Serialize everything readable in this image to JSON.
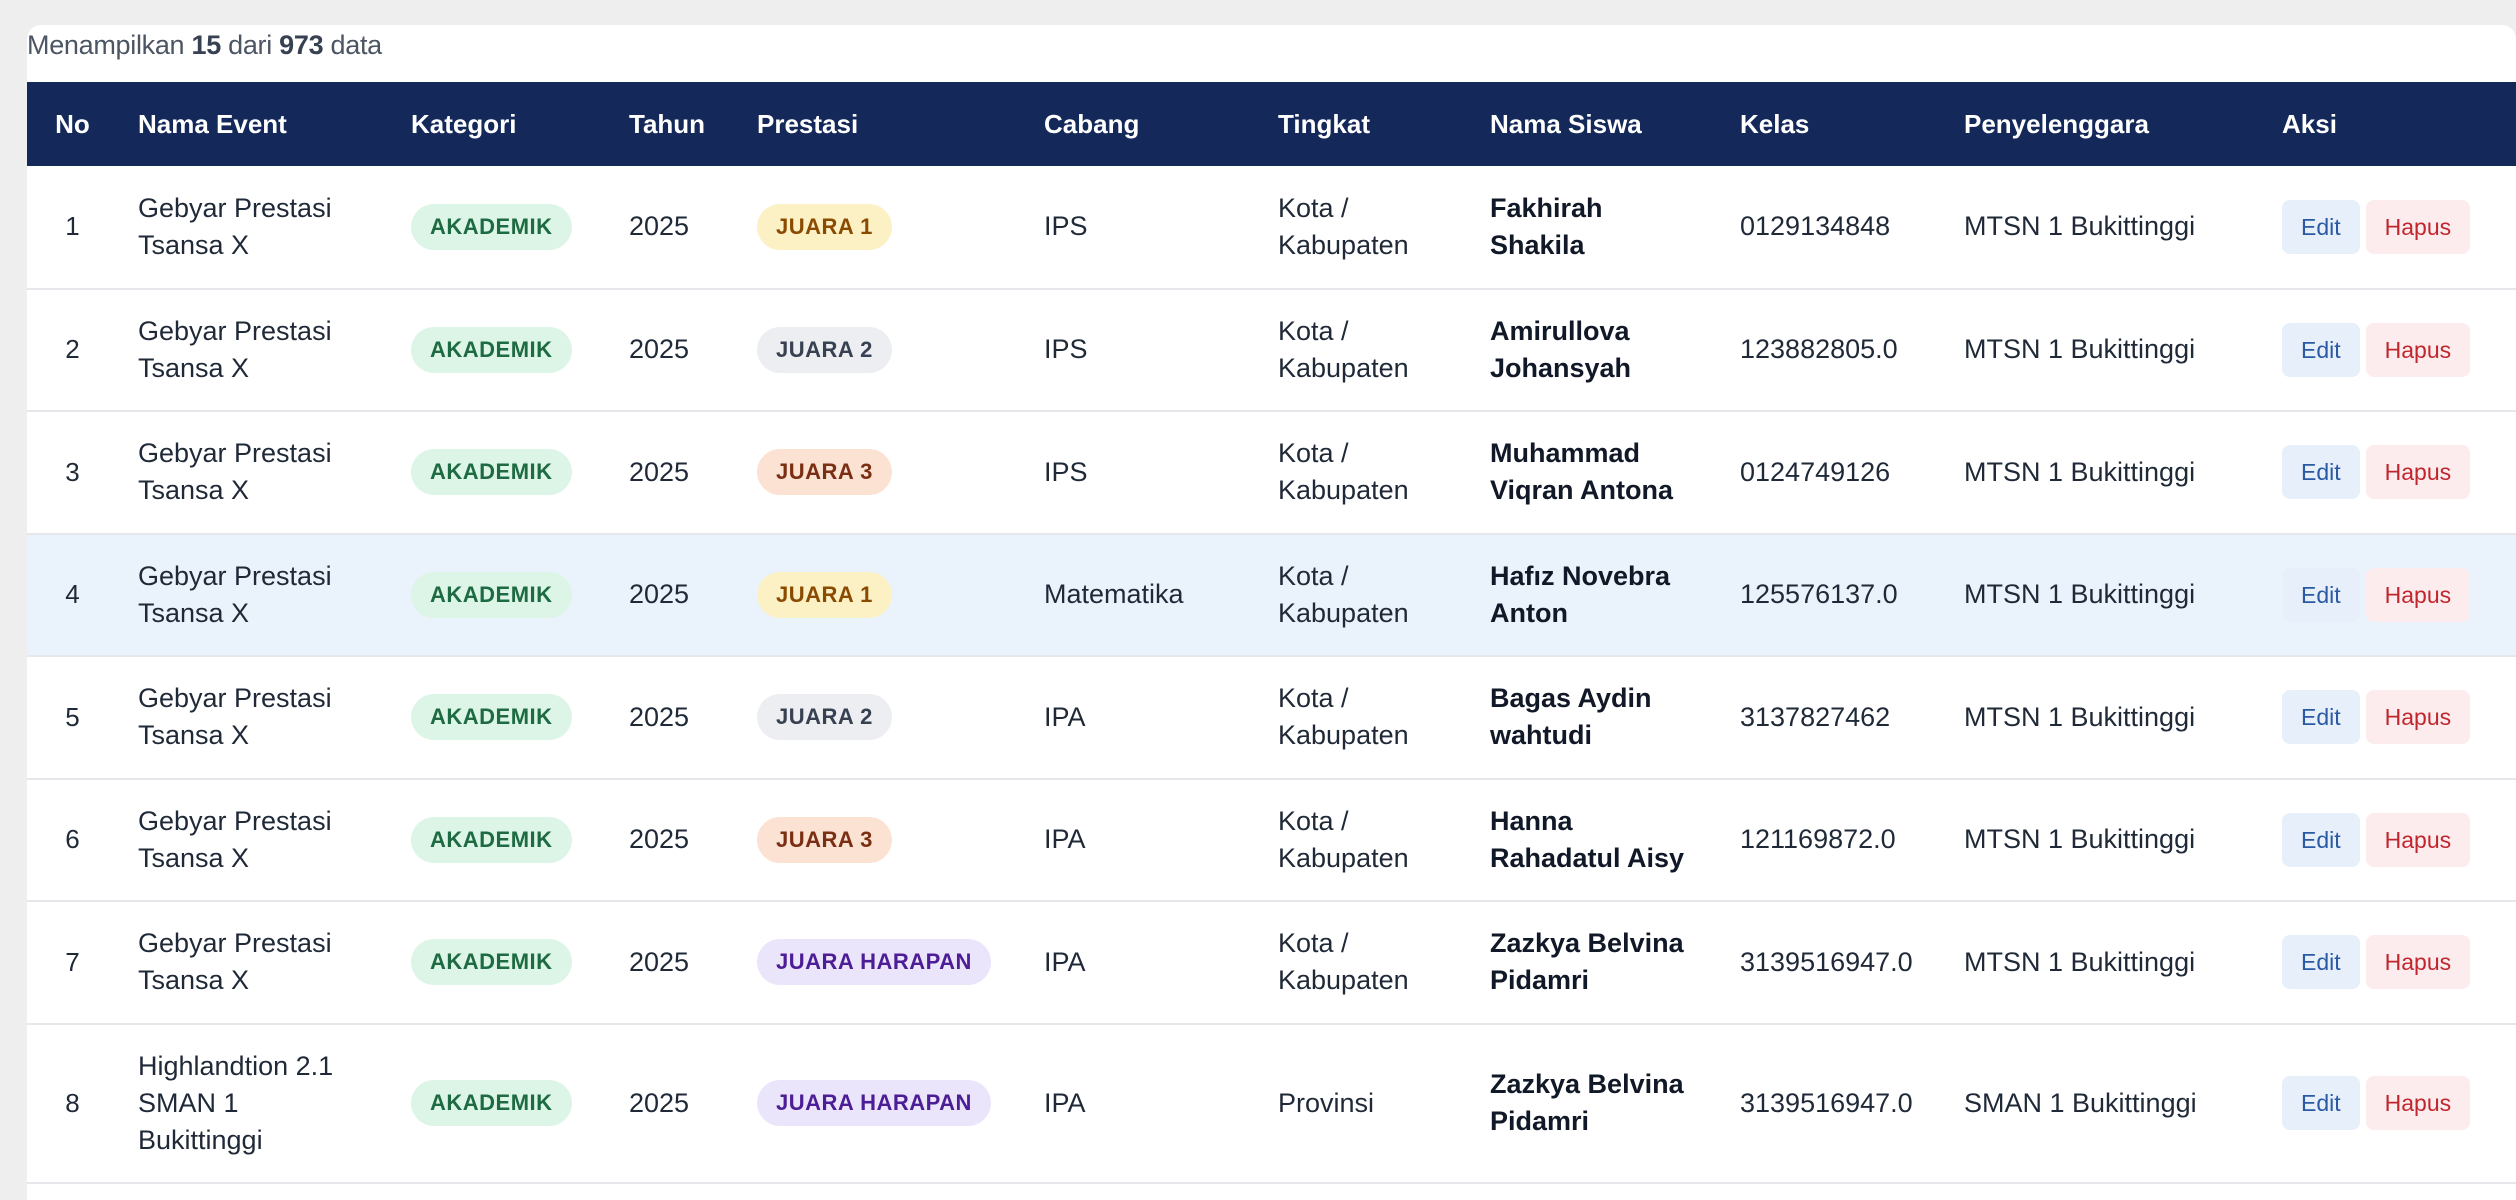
{
  "summary": {
    "prefix": "Menampilkan",
    "shown": "15",
    "middle": "dari",
    "total": "973",
    "suffix": "data"
  },
  "columns": {
    "no": "No",
    "event": "Nama Event",
    "kategori": "Kategori",
    "tahun": "Tahun",
    "prestasi": "Prestasi",
    "cabang": "Cabang",
    "tingkat": "Tingkat",
    "siswa": "Nama Siswa",
    "kelas": "Kelas",
    "penyelenggara": "Penyelenggara",
    "aksi": "Aksi"
  },
  "actions": {
    "edit": "Edit",
    "delete": "Hapus"
  },
  "badge_colors": {
    "kategori_bg": "#dcf5e7",
    "juara1_bg": "#fcf1c5",
    "juara2_bg": "#eceef1",
    "juara3_bg": "#fbe2d2",
    "harapan_bg": "#ebe5fb",
    "header_bg": "#14295a"
  },
  "rows": [
    {
      "no": "1",
      "event_line1": "Gebyar Prestasi",
      "event_line2": "Tsansa X",
      "event_line3": "",
      "kategori": "AKADEMIK",
      "tahun": "2025",
      "prestasi": "JUARA 1",
      "cabang": "IPS",
      "tingkat_line1": "Kota /",
      "tingkat_line2": "Kabupaten",
      "siswa_line1": "Fakhirah",
      "siswa_line2": "Shakila",
      "kelas": "0129134848",
      "penyelenggara": "MTSN 1 Bukittinggi"
    },
    {
      "no": "2",
      "event_line1": "Gebyar Prestasi",
      "event_line2": "Tsansa X",
      "event_line3": "",
      "kategori": "AKADEMIK",
      "tahun": "2025",
      "prestasi": "JUARA 2",
      "cabang": "IPS",
      "tingkat_line1": "Kota /",
      "tingkat_line2": "Kabupaten",
      "siswa_line1": "Amirullova",
      "siswa_line2": "Johansyah",
      "kelas": "123882805.0",
      "penyelenggara": "MTSN 1 Bukittinggi"
    },
    {
      "no": "3",
      "event_line1": "Gebyar Prestasi",
      "event_line2": "Tsansa X",
      "event_line3": "",
      "kategori": "AKADEMIK",
      "tahun": "2025",
      "prestasi": "JUARA 3",
      "cabang": "IPS",
      "tingkat_line1": "Kota /",
      "tingkat_line2": "Kabupaten",
      "siswa_line1": "Muhammad",
      "siswa_line2": "Viqran Antona",
      "kelas": "0124749126",
      "penyelenggara": "MTSN 1 Bukittinggi"
    },
    {
      "no": "4",
      "event_line1": "Gebyar Prestasi",
      "event_line2": "Tsansa X",
      "event_line3": "",
      "kategori": "AKADEMIK",
      "tahun": "2025",
      "prestasi": "JUARA 1",
      "cabang": "Matematika",
      "tingkat_line1": "Kota /",
      "tingkat_line2": "Kabupaten",
      "siswa_line1": "Hafız Novebra",
      "siswa_line2": "Anton",
      "kelas": "125576137.0",
      "penyelenggara": "MTSN 1 Bukittinggi"
    },
    {
      "no": "5",
      "event_line1": "Gebyar Prestasi",
      "event_line2": "Tsansa X",
      "event_line3": "",
      "kategori": "AKADEMIK",
      "tahun": "2025",
      "prestasi": "JUARA 2",
      "cabang": "IPA",
      "tingkat_line1": "Kota /",
      "tingkat_line2": "Kabupaten",
      "siswa_line1": "Bagas Aydin",
      "siswa_line2": "wahtudi",
      "kelas": "3137827462",
      "penyelenggara": "MTSN 1 Bukittinggi"
    },
    {
      "no": "6",
      "event_line1": "Gebyar Prestasi",
      "event_line2": "Tsansa X",
      "event_line3": "",
      "kategori": "AKADEMIK",
      "tahun": "2025",
      "prestasi": "JUARA 3",
      "cabang": "IPA",
      "tingkat_line1": "Kota /",
      "tingkat_line2": "Kabupaten",
      "siswa_line1": "Hanna",
      "siswa_line2": "Rahadatul Aisy",
      "kelas": "121169872.0",
      "penyelenggara": "MTSN 1 Bukittinggi"
    },
    {
      "no": "7",
      "event_line1": "Gebyar Prestasi",
      "event_line2": "Tsansa X",
      "event_line3": "",
      "kategori": "AKADEMIK",
      "tahun": "2025",
      "prestasi": "JUARA HARAPAN",
      "cabang": "IPA",
      "tingkat_line1": "Kota /",
      "tingkat_line2": "Kabupaten",
      "siswa_line1": "Zazkya Belvina",
      "siswa_line2": "Pidamri",
      "kelas": "3139516947.0",
      "penyelenggara": "MTSN 1 Bukittinggi"
    },
    {
      "no": "8",
      "event_line1": "Highlandtion 2.1",
      "event_line2": "SMAN 1",
      "event_line3": "Bukittinggi",
      "kategori": "AKADEMIK",
      "tahun": "2025",
      "prestasi": "JUARA HARAPAN",
      "cabang": "IPA",
      "tingkat_line1": "Provinsi",
      "tingkat_line2": "",
      "siswa_line1": "Zazkya Belvina",
      "siswa_line2": "Pidamri",
      "kelas": "3139516947.0",
      "penyelenggara": "SMAN 1 Bukittinggi"
    }
  ]
}
